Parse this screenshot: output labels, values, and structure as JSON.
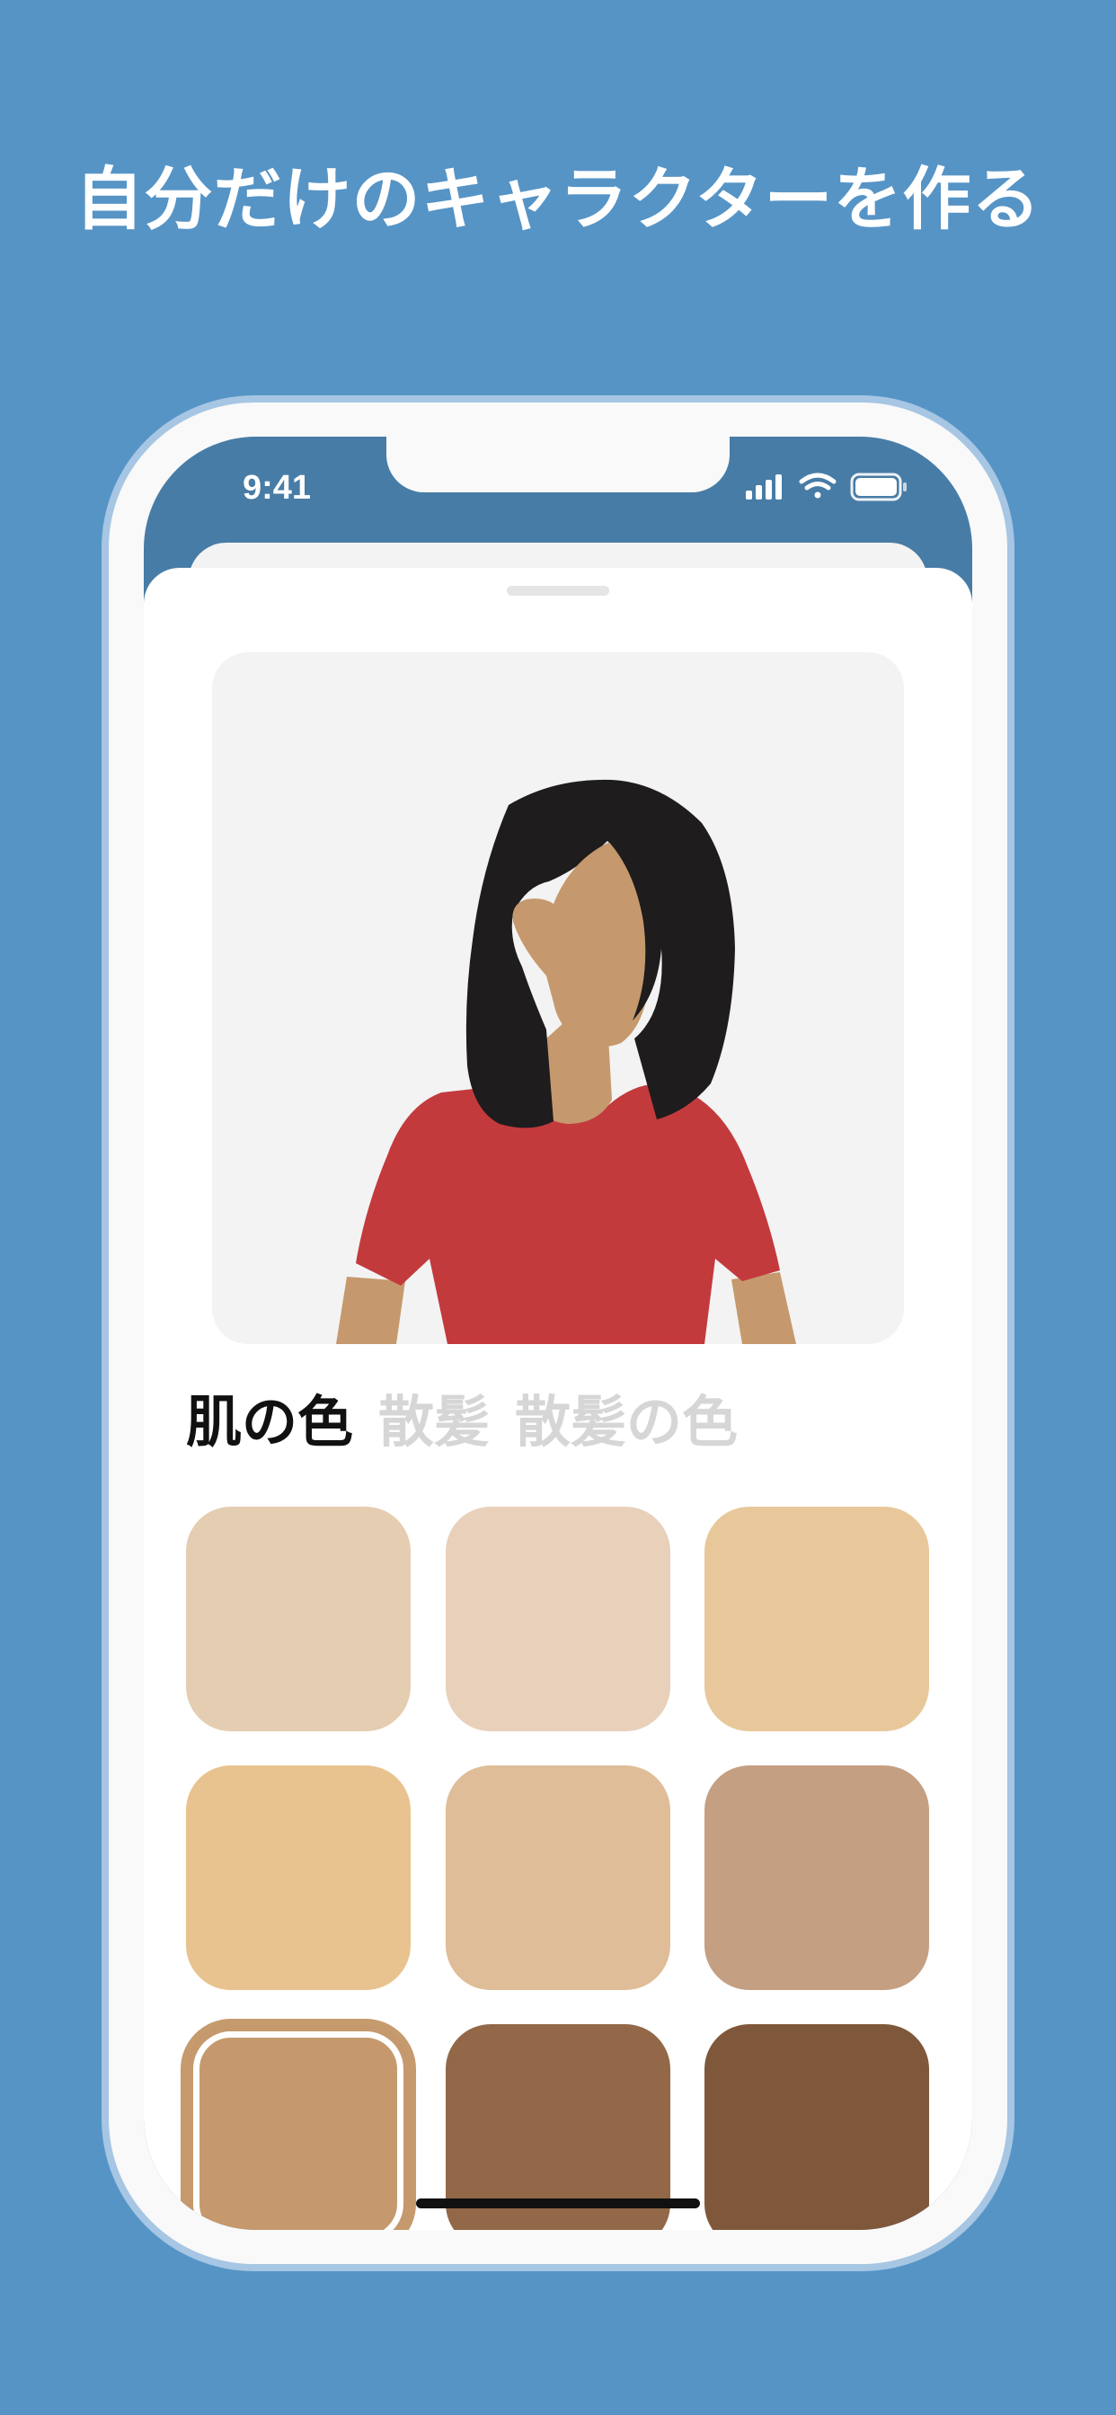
{
  "headline": "自分だけのキャラクターを作る",
  "status_bar": {
    "time": "9:41",
    "icons": [
      "signal-icon",
      "wifi-icon",
      "battery-icon"
    ]
  },
  "editor": {
    "tabs": [
      {
        "label": "肌の色",
        "active": true
      },
      {
        "label": "散髪",
        "active": false
      },
      {
        "label": "散髪の色",
        "active": false
      }
    ],
    "selected_swatch_index": 6,
    "skin_swatches": [
      {
        "color": "#e5cdb1"
      },
      {
        "color": "#e8d0ba"
      },
      {
        "color": "#e8c89a"
      },
      {
        "color": "#e8c38f"
      },
      {
        "color": "#dfbd98"
      },
      {
        "color": "#c59f82"
      },
      {
        "color": "#c5996d"
      },
      {
        "color": "#926848"
      },
      {
        "color": "#7f583b"
      }
    ]
  },
  "character": {
    "skin_color": "#c5996d",
    "hair_color": "#1f1c1d",
    "shirt_color": "#c33a3d"
  },
  "colors": {
    "background": "#5694c6",
    "screen_header": "#477ca6",
    "active_tab": "#111111",
    "inactive_tab": "#d6d6d6"
  }
}
